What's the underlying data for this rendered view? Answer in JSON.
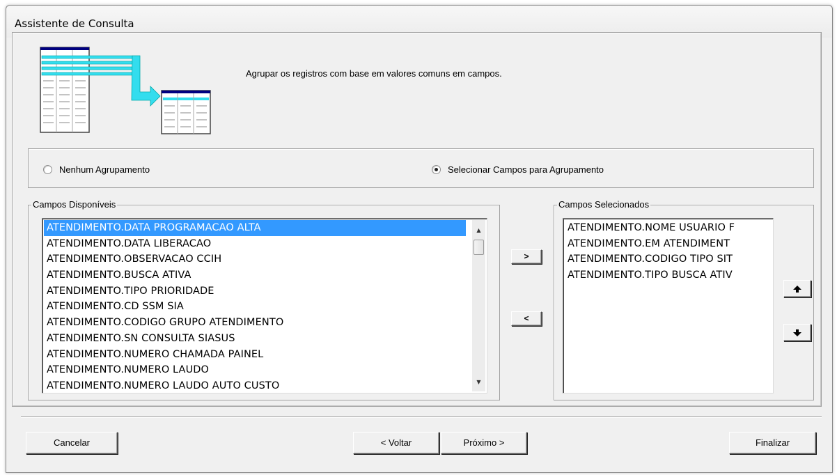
{
  "window": {
    "title": "Assistente de Consulta"
  },
  "header": {
    "description": "Agrupar os registros com base em valores comuns em campos.",
    "illustration_icon": "table-grouping-illustration"
  },
  "grouping": {
    "option_none": "Nenhum Agrupamento",
    "option_select": "Selecionar Campos para Agrupamento",
    "selected": "option_select"
  },
  "available": {
    "legend": "Campos Disponíveis",
    "items": [
      "ATENDIMENTO.DATA PROGRAMACAO ALTA",
      "ATENDIMENTO.DATA LIBERACAO",
      "ATENDIMENTO.OBSERVACAO CCIH",
      "ATENDIMENTO.BUSCA ATIVA",
      "ATENDIMENTO.TIPO PRIORIDADE",
      "ATENDIMENTO.CD SSM SIA",
      "ATENDIMENTO.CODIGO GRUPO ATENDIMENTO",
      "ATENDIMENTO.SN CONSULTA SIASUS",
      "ATENDIMENTO.NUMERO CHAMADA PAINEL",
      "ATENDIMENTO.NUMERO LAUDO",
      "ATENDIMENTO.NUMERO LAUDO AUTO CUSTO"
    ],
    "selected_index": 0
  },
  "selected": {
    "legend": "Campos Selecionados",
    "items": [
      "ATENDIMENTO.NOME USUARIO F",
      "ATENDIMENTO.EM ATENDIMENT",
      "ATENDIMENTO.CODIGO TIPO SIT",
      "ATENDIMENTO.TIPO BUSCA ATIV"
    ]
  },
  "transfer": {
    "add_label": ">",
    "remove_label": "<"
  },
  "order": {
    "up_icon": "arrow-up-icon",
    "down_icon": "arrow-down-icon"
  },
  "footer": {
    "cancel_label": "Cancelar",
    "back_label": "< Voltar",
    "next_label": "Próximo >",
    "finish_label": "Finalizar"
  },
  "colors": {
    "selection": "#3399ff",
    "arrow_cyan": "#33ddee",
    "table_header": "#000080"
  }
}
